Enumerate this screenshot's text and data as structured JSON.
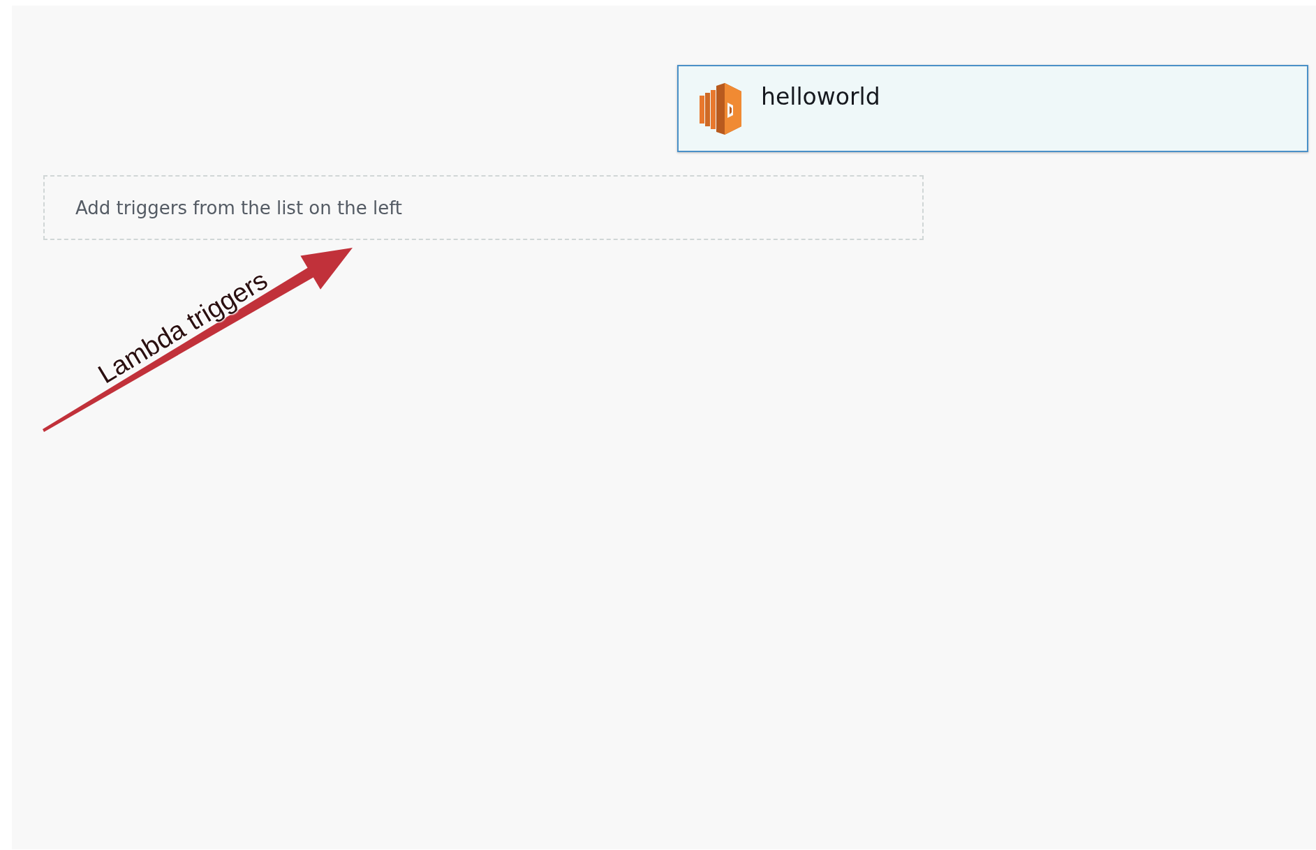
{
  "function_card": {
    "name": "helloworld"
  },
  "trigger_area": {
    "text": "Add triggers from the list on the left"
  },
  "annotation": {
    "text": "Lambda triggers"
  }
}
